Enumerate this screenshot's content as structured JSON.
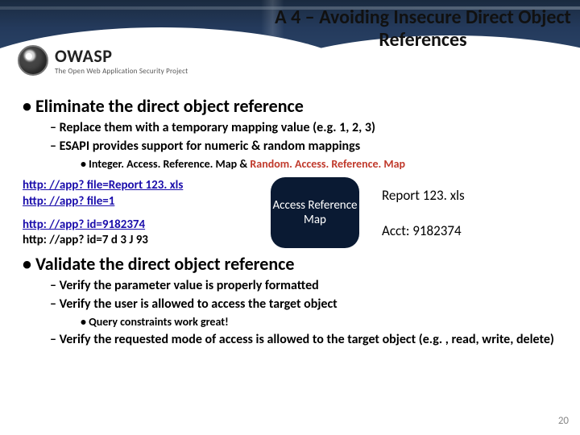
{
  "header": {
    "title": "A 4 – Avoiding Insecure Direct Object References",
    "logo_big": "OWASP",
    "logo_small": "The Open Web Application Security Project"
  },
  "bullets": {
    "l1a": "Eliminate the direct object reference",
    "l2a": "Replace them with a temporary mapping value (e.g. 1, 2, 3)",
    "l2b": "ESAPI provides support for numeric & random mappings",
    "l3a_black": "Integer. Access. Reference. Map",
    "l3a_amp": " & ",
    "l3a_red": "Random. Access. Reference. Map",
    "l1b": "Validate the direct object reference",
    "l2c": "Verify the parameter value is properly formatted",
    "l2d": "Verify the user is allowed to access the target object",
    "l3b": "Query constraints work great!",
    "l2e": "Verify the requested mode of access is allowed to the target object (e.g. , read, write, delete)"
  },
  "mid": {
    "link1": "http: //app? file=Report 123. xls",
    "link2": "http: //app? file=1",
    "link3": "http: //app? id=9182374",
    "text4": "http: //app? id=7 d 3 J 93",
    "bubble": "Access Reference Map",
    "right1": "Report 123. xls",
    "right2": "Acct: 9182374"
  },
  "pageno": "20"
}
